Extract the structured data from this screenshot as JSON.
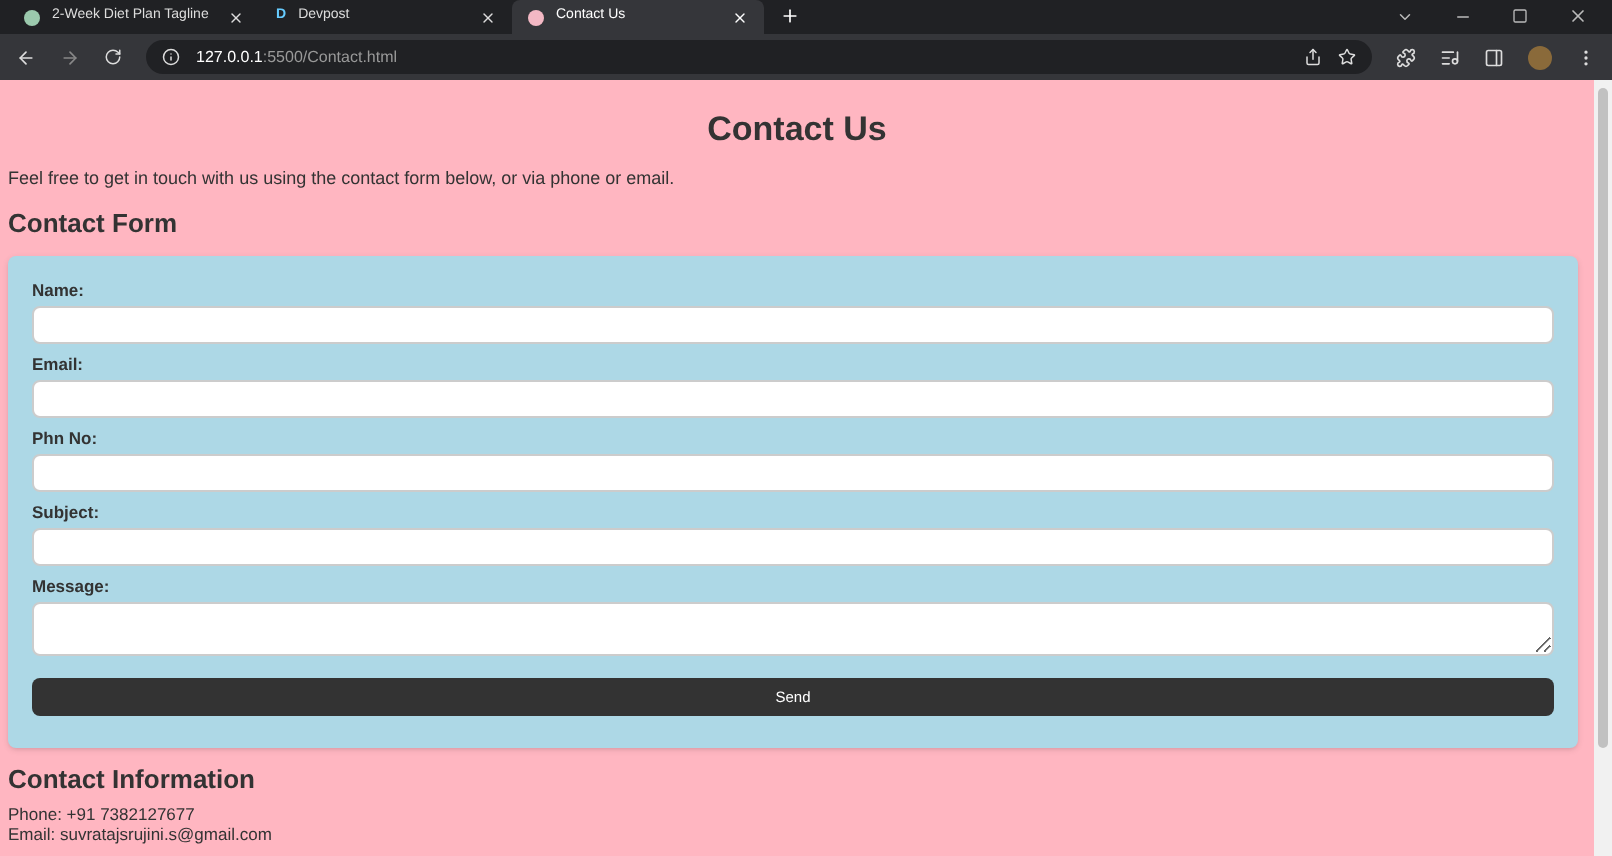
{
  "browser": {
    "tabs": [
      {
        "title": "2-Week Diet Plan Tagline",
        "selected": false
      },
      {
        "title": "Devpost",
        "favicon": "D",
        "selected": false
      },
      {
        "title": "Contact Us",
        "selected": true
      }
    ],
    "url_host": "127.0.0.1",
    "url_path": ":5500/Contact.html"
  },
  "page": {
    "title": "Contact Us",
    "intro": "Feel free to get in touch with us using the contact form below, or via phone or email.",
    "form_heading": "Contact Form",
    "fields": [
      {
        "label": "Name:",
        "kind": "input"
      },
      {
        "label": "Email:",
        "kind": "input"
      },
      {
        "label": "Phn No:",
        "kind": "input"
      },
      {
        "label": "Subject:",
        "kind": "input"
      },
      {
        "label": "Message:",
        "kind": "textarea"
      }
    ],
    "submit": "Send",
    "info_heading": "Contact Information",
    "info_lines": [
      "Phone: +91 7382127677",
      "Email: suvratajsrujini.s@gmail.com"
    ]
  }
}
